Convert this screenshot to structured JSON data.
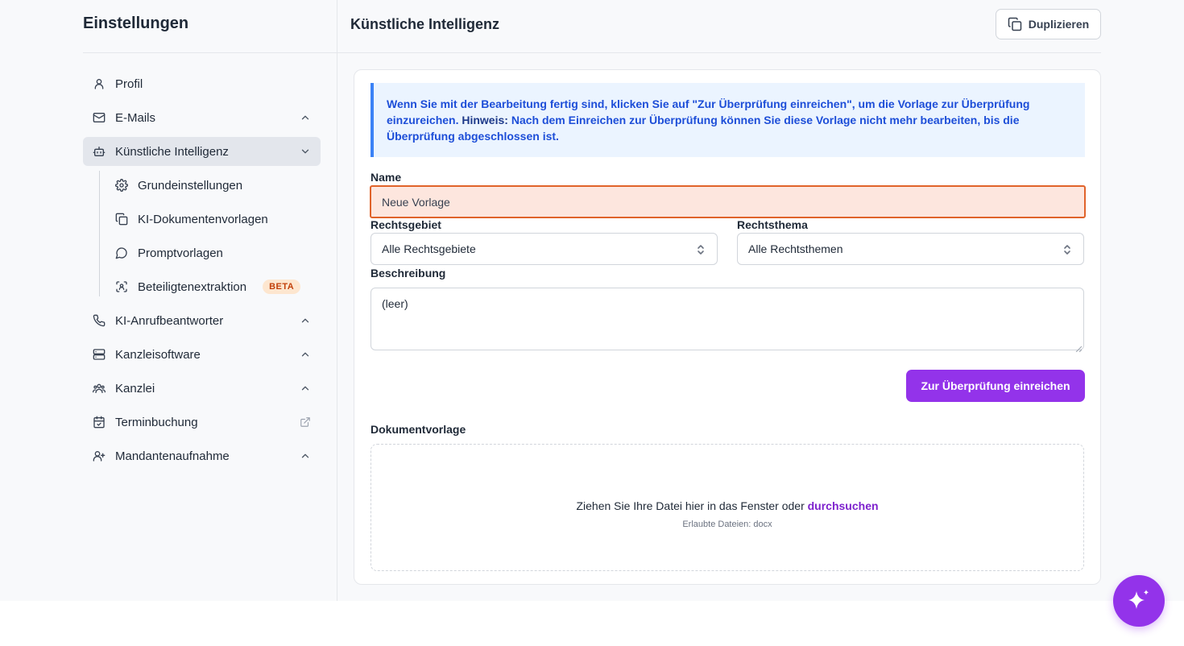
{
  "sidebar": {
    "title": "Einstellungen",
    "items": [
      {
        "label": "Profil",
        "icon": "user-icon"
      },
      {
        "label": "E-Mails",
        "icon": "mail-icon",
        "chevron": "up"
      },
      {
        "label": "Künstliche Intelligenz",
        "icon": "bot-icon",
        "chevron": "down",
        "active": true
      },
      {
        "label": "KI-Anrufbeantworter",
        "icon": "phone-icon",
        "chevron": "up"
      },
      {
        "label": "Kanzleisoftware",
        "icon": "server-icon",
        "chevron": "up"
      },
      {
        "label": "Kanzlei",
        "icon": "users-icon",
        "chevron": "up"
      },
      {
        "label": "Terminbuchung",
        "icon": "calendar-icon",
        "external": true
      },
      {
        "label": "Mandantenaufnahme",
        "icon": "user-plus-icon",
        "chevron": "up"
      }
    ],
    "subitems": [
      {
        "label": "Grundeinstellungen",
        "icon": "gear-icon"
      },
      {
        "label": "KI-Dokumentenvorlagen",
        "icon": "copy-icon"
      },
      {
        "label": "Promptvorlagen",
        "icon": "chat-icon"
      },
      {
        "label": "Beteiligtenextraktion",
        "icon": "scan-icon",
        "badge": "BETA"
      }
    ]
  },
  "header": {
    "title": "Künstliche Intelligenz",
    "duplicate_label": "Duplizieren"
  },
  "notice": {
    "text_1": "Wenn Sie mit der Bearbeitung fertig sind, klicken Sie auf \"Zur Überprüfung einreichen\", um die Vorlage zur Überprüfung einzureichen.",
    "hint_label": "Hinweis:",
    "text_2": "Nach dem Einreichen zur Überprüfung können Sie diese Vorlage nicht mehr bearbeiten, bis die Überprüfung abgeschlossen ist."
  },
  "form": {
    "name_label": "Name",
    "name_value": "Neue Vorlage",
    "area_label": "Rechtsgebiet",
    "area_value": "Alle Rechtsgebiete",
    "topic_label": "Rechtsthema",
    "topic_value": "Alle Rechtsthemen",
    "description_label": "Beschreibung",
    "description_value": "(leer)",
    "submit_label": "Zur Überprüfung einreichen",
    "document_label": "Dokumentvorlage",
    "drop_text": "Ziehen Sie Ihre Datei hier in das Fenster oder",
    "drop_link": "durchsuchen",
    "drop_hint": "Erlaubte Dateien: docx"
  },
  "colors": {
    "accent": "#9333ea",
    "notice_bg": "#ebf4ff",
    "notice_border": "#3b82f6",
    "error_border": "#e0632a",
    "error_bg": "#fde6de",
    "beta_bg": "#fde6cf"
  }
}
